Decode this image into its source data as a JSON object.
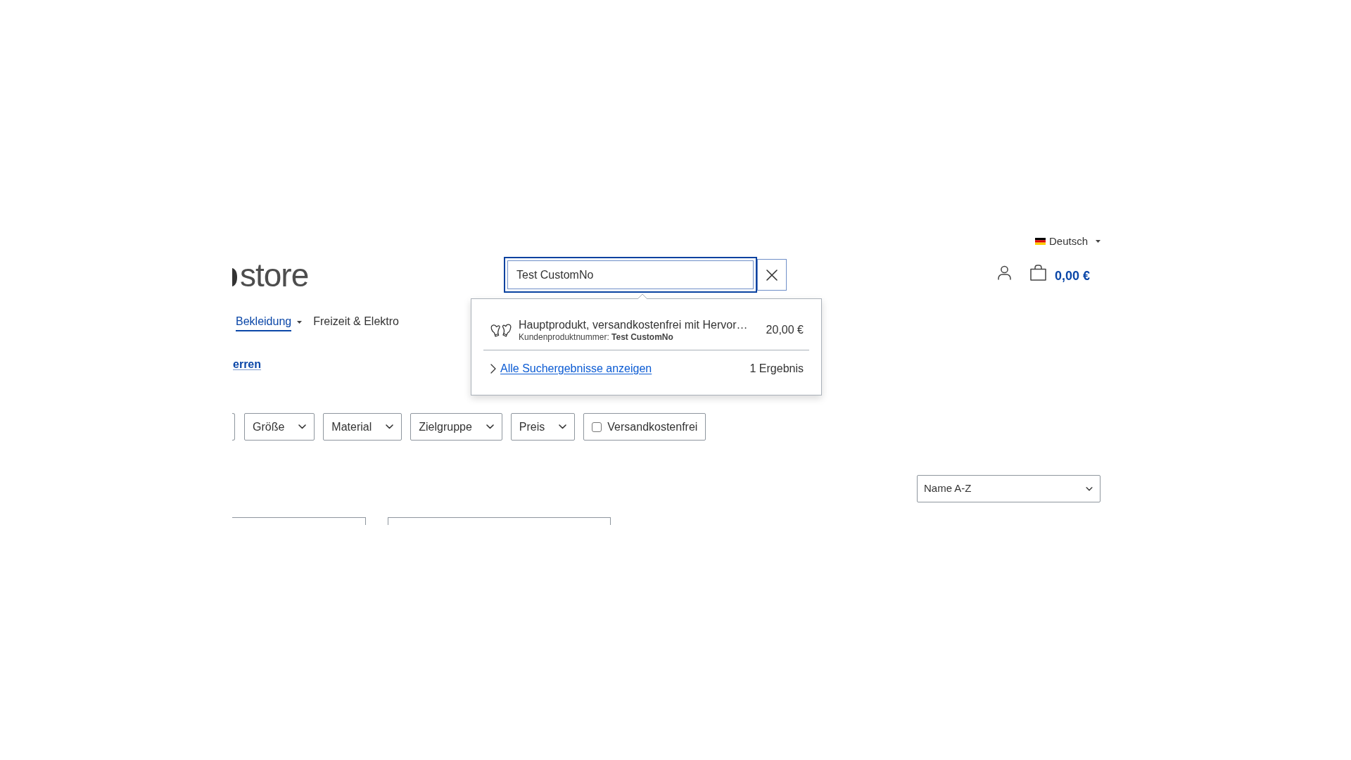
{
  "language": {
    "label": "Deutsch"
  },
  "logo": {
    "text": "store"
  },
  "search": {
    "value": "Test CustomNo",
    "suggestions": [
      {
        "title": "Hauptprodukt, versandkostenfrei mit Hervor…",
        "meta": "Kundenproduktnummer: **Test CustomNo**",
        "price": "20,00 €"
      }
    ],
    "show_all": "Alle Suchergebnisse anzeigen",
    "result_count": "1 Ergebnis"
  },
  "cart": {
    "total": "0,00 €"
  },
  "nav": [
    {
      "label": "Bekleidung",
      "selected": true,
      "has_dropdown": true
    },
    {
      "label": "Freizeit & Elektro",
      "selected": false,
      "has_dropdown": false
    }
  ],
  "sub_link": "erren",
  "filters": [
    {
      "kind": "dropdown",
      "label": "Größe"
    },
    {
      "kind": "dropdown",
      "label": "Material"
    },
    {
      "kind": "dropdown",
      "label": "Zielgruppe"
    },
    {
      "kind": "dropdown",
      "label": "Preis"
    },
    {
      "kind": "checkbox",
      "label": "Versandkostenfrei",
      "checked": false
    }
  ],
  "sort": {
    "value": "Name A-Z"
  }
}
